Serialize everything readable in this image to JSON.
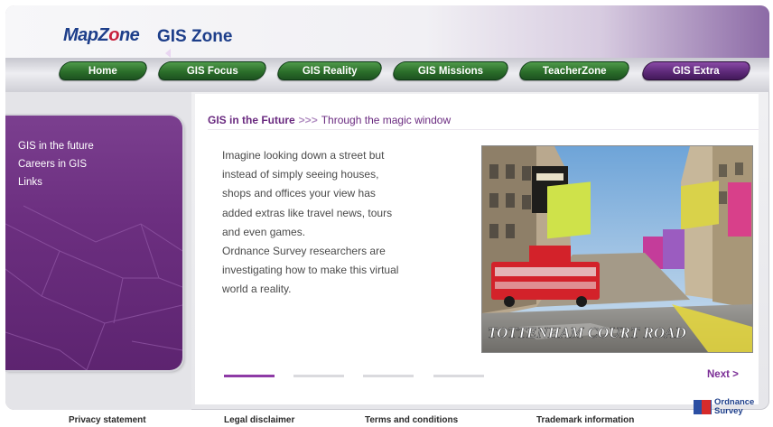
{
  "header": {
    "logo": {
      "part1": "MapZ",
      "part2": "ne"
    },
    "title": "GIS Zone"
  },
  "nav": {
    "tabs": [
      {
        "label": "Home",
        "active": false
      },
      {
        "label": "GIS Focus",
        "active": false
      },
      {
        "label": "GIS Reality",
        "active": false
      },
      {
        "label": "GIS Missions",
        "active": false
      },
      {
        "label": "TeacherZone",
        "active": false
      },
      {
        "label": "GIS Extra",
        "active": true
      }
    ]
  },
  "sidebar": {
    "items": [
      {
        "label": "GIS in the future",
        "active": true
      },
      {
        "label": "Careers in GIS",
        "active": false
      },
      {
        "label": "Links",
        "active": false
      }
    ]
  },
  "breadcrumb": {
    "section": "GIS in the Future",
    "separator": ">>>",
    "page": "Through the magic window"
  },
  "body": {
    "lines": [
      "Imagine looking down a street but",
      "instead of simply seeing houses,",
      "shops and offices your view has",
      "added extras like travel news, tours",
      "and even games.",
      "Ordnance Survey researchers are",
      "investigating how to make this virtual",
      "world a reality."
    ]
  },
  "photo": {
    "street_sign": "TOTTENHAM COURT ROAD"
  },
  "pager": {
    "total": 4,
    "current": 1,
    "next_label": "Next >"
  },
  "footer": {
    "links": [
      "Privacy statement",
      "Legal disclaimer",
      "Terms and conditions",
      "Trademark information"
    ],
    "brand": {
      "line1": "Ordnance",
      "line2": "Survey"
    }
  },
  "colors": {
    "accent_purple": "#6a2a80",
    "nav_green": "#2b6e2a",
    "brand_blue": "#1d3e8a"
  }
}
